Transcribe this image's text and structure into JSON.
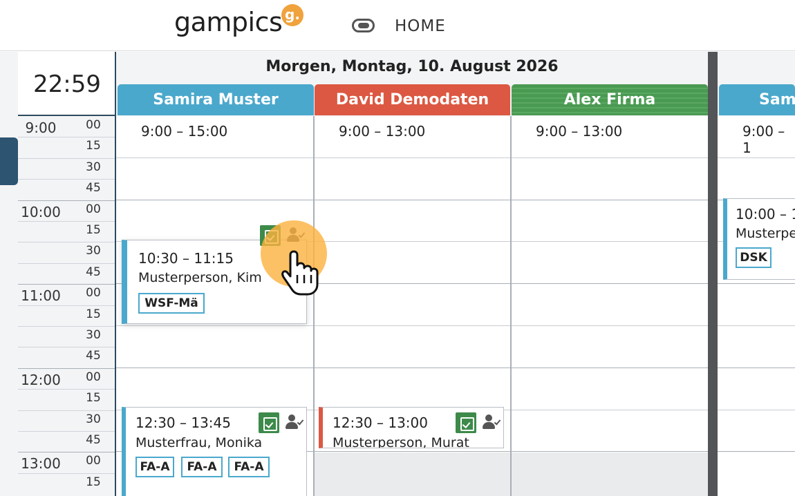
{
  "header": {
    "logo": "gampics",
    "logo_badge": "g.",
    "home_label": "HOME"
  },
  "clock": "22:59",
  "day_title": "Morgen, Montag, 10. August 2026",
  "time_rows": [
    {
      "hour": "9:00",
      "mins": [
        "00",
        "15",
        "30",
        "45"
      ]
    },
    {
      "hour": "10:00",
      "mins": [
        "00",
        "15",
        "30",
        "45"
      ]
    },
    {
      "hour": "11:00",
      "mins": [
        "00",
        "15",
        "30",
        "45"
      ]
    },
    {
      "hour": "12:00",
      "mins": [
        "00",
        "15",
        "30",
        "45"
      ]
    },
    {
      "hour": "13:00",
      "mins": [
        "00",
        "15"
      ]
    }
  ],
  "staff": [
    {
      "name": "Samira Muster",
      "color": "#4aa8cc",
      "shift": "9:00 – 15:00"
    },
    {
      "name": "David Demodaten",
      "color": "#dc5842",
      "shift": "9:00 – 13:00"
    },
    {
      "name": "Alex Firma",
      "color": "#4a9a52",
      "shift": "9:00 – 13:00"
    },
    {
      "name": "Sam",
      "color": "#4aa8cc",
      "shift": "9:00 – 1"
    }
  ],
  "appointments": {
    "a1": {
      "time": "10:30 – 11:15",
      "name": "Musterperson, Kim",
      "tags": [
        "WSF-Mä"
      ]
    },
    "a2": {
      "time": "12:30 – 13:45",
      "name": "Musterfrau, Monika",
      "tags": [
        "FA-A",
        "FA-A",
        "FA-A"
      ]
    },
    "a3": {
      "time": "12:30 – 13:00",
      "name": "Musterperson, Murat",
      "tags": []
    },
    "a4": {
      "time": "10:00 – 1",
      "name": "Musterpe",
      "tags": [
        "DSK"
      ]
    }
  }
}
